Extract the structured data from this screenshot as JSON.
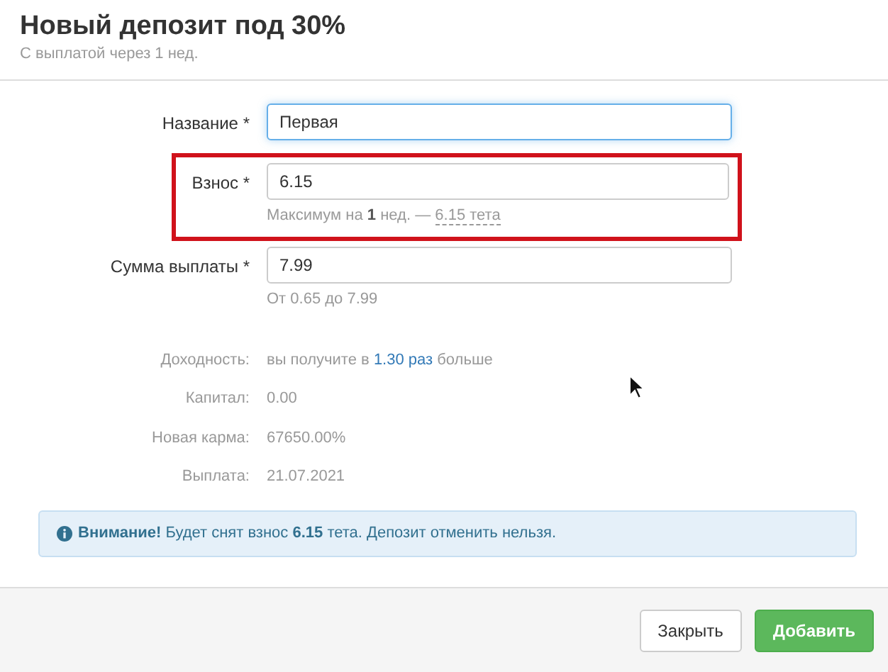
{
  "dialog": {
    "title": "Новый депозит под 30%",
    "subtitle": "С выплатой через 1 нед."
  },
  "fields": [
    {
      "label": "Название *",
      "value": "Первая",
      "focused": true,
      "highlighted": false
    },
    {
      "label": "Взнос *",
      "value": "6.15",
      "focused": false,
      "highlighted": true,
      "help": "Максимум на **1** нед. —",
      "help_link": "6.15 тета"
    },
    {
      "label": "Сумма выплаты *",
      "value": "7.99",
      "focused": false,
      "highlighted": false,
      "help": "От 0.65 до 7.99"
    }
  ],
  "summary": [
    {
      "label": "Доходность:",
      "value": "вы получите в",
      "value_accent": "1.30 раз",
      "value_after": "больше"
    },
    {
      "label": "Капитал:",
      "value": "0.00"
    },
    {
      "label": "Новая карма:",
      "value": "67650.00%"
    },
    {
      "label": "Выплата:",
      "value": "21.07.2021"
    }
  ],
  "alert": {
    "text": "**Внимание!** Будет снят взнос **6.15** тета. Депозит отменить нельзя."
  },
  "buttons": [
    {
      "label": "Закрыть",
      "kind": "secondary"
    },
    {
      "label": "Добавить",
      "kind": "primary"
    }
  ]
}
